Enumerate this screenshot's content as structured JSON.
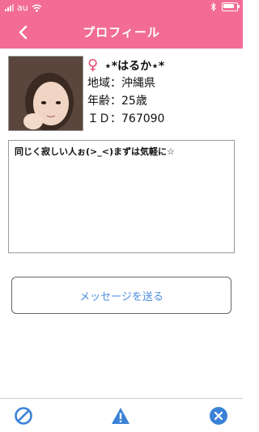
{
  "status_bar": {
    "carrier": "au",
    "icons": [
      "signal-icon",
      "wifi-icon",
      "bluetooth-icon",
      "battery-icon"
    ]
  },
  "nav": {
    "title": "プロフィール",
    "back_icon": "chevron-left-icon"
  },
  "profile": {
    "gender_icon": "female-icon",
    "name": "⋆*はるか⋆*",
    "region": "地域：沖縄県",
    "age": "年齢：25歳",
    "id": "ＩＤ：767090",
    "message": "同じく寂しい人ぉ(>_<)まずは気軽に☆"
  },
  "actions": {
    "send_message": "メッセージを送る"
  },
  "bottom_bar": {
    "items": [
      "block-icon",
      "report-icon",
      "close-icon"
    ]
  },
  "colors": {
    "header": "#f26c95",
    "link": "#4a8ee0",
    "icon_blue": "#3b82d6",
    "female": "#e84a6f"
  }
}
